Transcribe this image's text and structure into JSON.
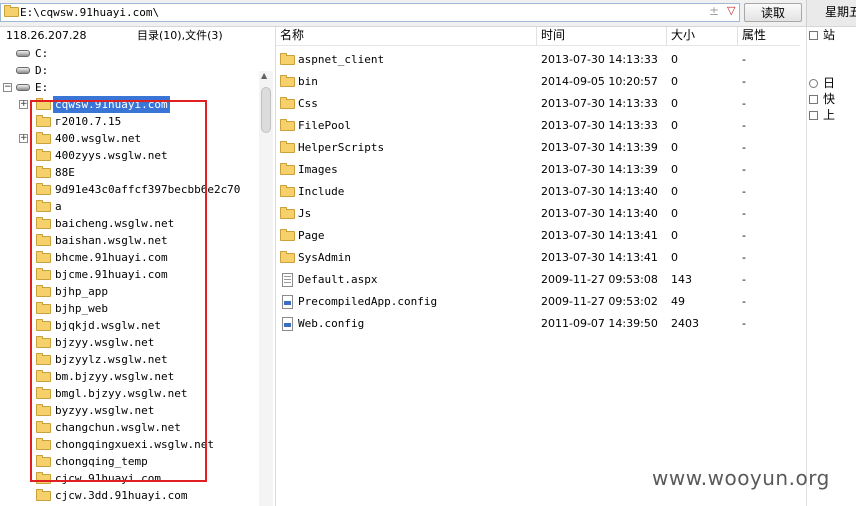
{
  "address_bar": {
    "path": "E:\\cqwsw.91huayi.com\\",
    "favorite_icon": "plus-icon",
    "dropdown_icon": "chevron-down-icon",
    "read_button_label": "读取",
    "weekday_tab_label": "星期五"
  },
  "left_panel": {
    "ip": "118.26.207.28",
    "summary": "目录(10),文件(3)",
    "drives": [
      {
        "label": "C:"
      },
      {
        "label": "D:"
      },
      {
        "label": "E:"
      }
    ],
    "folders": [
      {
        "label": "cqwsw.91huayi.com",
        "expandable": true,
        "selected": true
      },
      {
        "label": "г2010.7.15",
        "expandable": false
      },
      {
        "label": "400.wsglw.net",
        "expandable": true
      },
      {
        "label": "400zyys.wsglw.net",
        "expandable": false
      },
      {
        "label": "88E",
        "expandable": false
      },
      {
        "label": "9d91e43c0affcf397becbb6e2c70",
        "expandable": false
      },
      {
        "label": "a",
        "expandable": false
      },
      {
        "label": "baicheng.wsglw.net",
        "expandable": false
      },
      {
        "label": "baishan.wsglw.net",
        "expandable": false
      },
      {
        "label": "bhcme.91huayi.com",
        "expandable": false
      },
      {
        "label": "bjcme.91huayi.com",
        "expandable": false
      },
      {
        "label": "bjhp_app",
        "expandable": false
      },
      {
        "label": "bjhp_web",
        "expandable": false
      },
      {
        "label": "bjqkjd.wsglw.net",
        "expandable": false
      },
      {
        "label": "bjzyy.wsglw.net",
        "expandable": false
      },
      {
        "label": "bjzyylz.wsglw.net",
        "expandable": false
      },
      {
        "label": "bm.bjzyy.wsglw.net",
        "expandable": false
      },
      {
        "label": "bmgl.bjzyy.wsglw.net",
        "expandable": false
      },
      {
        "label": "byzyy.wsglw.net",
        "expandable": false
      },
      {
        "label": "changchun.wsglw.net",
        "expandable": false
      },
      {
        "label": "chongqingxuexi.wsglw.net",
        "expandable": false
      },
      {
        "label": "chongqing_temp",
        "expandable": false
      },
      {
        "label": "cjcw.91huayi.com",
        "expandable": false
      },
      {
        "label": "cjcw.3dd.91huayi.com",
        "expandable": false
      }
    ]
  },
  "file_list": {
    "columns": {
      "name": "名称",
      "time": "时间",
      "size": "大小",
      "attr": "属性"
    },
    "rows": [
      {
        "name": "aspnet_client",
        "time": "2013-07-30 14:13:33",
        "size": "0",
        "attr": "-",
        "type": "folder"
      },
      {
        "name": "bin",
        "time": "2014-09-05 10:20:57",
        "size": "0",
        "attr": "-",
        "type": "folder"
      },
      {
        "name": "Css",
        "time": "2013-07-30 14:13:33",
        "size": "0",
        "attr": "-",
        "type": "folder"
      },
      {
        "name": "FilePool",
        "time": "2013-07-30 14:13:33",
        "size": "0",
        "attr": "-",
        "type": "folder"
      },
      {
        "name": "HelperScripts",
        "time": "2013-07-30 14:13:39",
        "size": "0",
        "attr": "-",
        "type": "folder"
      },
      {
        "name": "Images",
        "time": "2013-07-30 14:13:39",
        "size": "0",
        "attr": "-",
        "type": "folder"
      },
      {
        "name": "Include",
        "time": "2013-07-30 14:13:40",
        "size": "0",
        "attr": "-",
        "type": "folder"
      },
      {
        "name": "Js",
        "time": "2013-07-30 14:13:40",
        "size": "0",
        "attr": "-",
        "type": "folder"
      },
      {
        "name": "Page",
        "time": "2013-07-30 14:13:41",
        "size": "0",
        "attr": "-",
        "type": "folder"
      },
      {
        "name": "SysAdmin",
        "time": "2013-07-30 14:13:41",
        "size": "0",
        "attr": "-",
        "type": "folder"
      },
      {
        "name": "Default.aspx",
        "time": "2009-11-27 09:53:08",
        "size": "143",
        "attr": "-",
        "type": "aspx"
      },
      {
        "name": "PrecompiledApp.config",
        "time": "2009-11-27 09:53:02",
        "size": "49",
        "attr": "-",
        "type": "config"
      },
      {
        "name": "Web.config",
        "time": "2011-09-07 14:39:50",
        "size": "2403",
        "attr": "-",
        "type": "config"
      }
    ]
  },
  "side_panel": {
    "items": [
      {
        "label": "站",
        "icon": "checkbox-icon"
      },
      {
        "label": "日",
        "icon": "clock-icon"
      },
      {
        "label": "快",
        "icon": "document-icon"
      },
      {
        "label": "上",
        "icon": "checkbox-icon"
      }
    ]
  },
  "watermark": "www.wooyun.org",
  "colors": {
    "highlight_box": "#e02020",
    "selection": "#3875d7",
    "folder": "#f6d16b"
  }
}
